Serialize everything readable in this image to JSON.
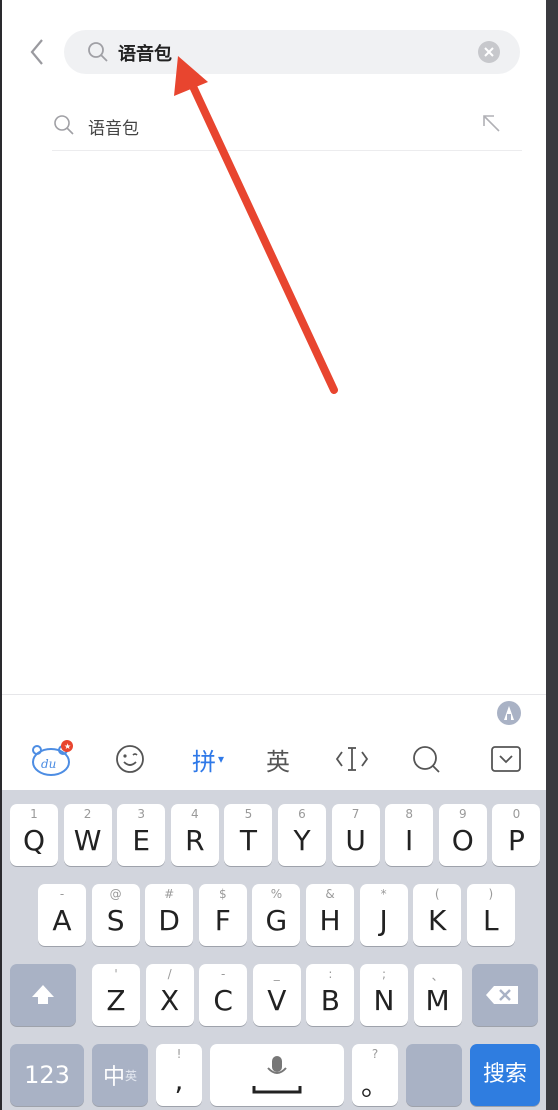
{
  "search": {
    "query": "语音包",
    "suggestion": "语音包"
  },
  "toolbar": {
    "pinyin_label": "拼",
    "english_label": "英"
  },
  "keyboard": {
    "row1": [
      {
        "sub": "1",
        "main": "Q"
      },
      {
        "sub": "2",
        "main": "W"
      },
      {
        "sub": "3",
        "main": "E"
      },
      {
        "sub": "4",
        "main": "R"
      },
      {
        "sub": "5",
        "main": "T"
      },
      {
        "sub": "6",
        "main": "Y"
      },
      {
        "sub": "7",
        "main": "U"
      },
      {
        "sub": "8",
        "main": "I"
      },
      {
        "sub": "9",
        "main": "O"
      },
      {
        "sub": "0",
        "main": "P"
      }
    ],
    "row2": [
      {
        "sub": "-",
        "main": "A"
      },
      {
        "sub": "@",
        "main": "S"
      },
      {
        "sub": "#",
        "main": "D"
      },
      {
        "sub": "$",
        "main": "F"
      },
      {
        "sub": "%",
        "main": "G"
      },
      {
        "sub": "&",
        "main": "H"
      },
      {
        "sub": "*",
        "main": "J"
      },
      {
        "sub": "(",
        "main": "K"
      },
      {
        "sub": ")",
        "main": "L"
      }
    ],
    "row3": [
      {
        "sub": "'",
        "main": "Z"
      },
      {
        "sub": "/",
        "main": "X"
      },
      {
        "sub": "-",
        "main": "C"
      },
      {
        "sub": "_",
        "main": "V"
      },
      {
        "sub": ":",
        "main": "B"
      },
      {
        "sub": ";",
        "main": "N"
      },
      {
        "sub": "、",
        "main": "M"
      }
    ],
    "num_label": "123",
    "zh_label": "中",
    "en_sub_label": "英",
    "comma_sub": "!",
    "comma_main": ",",
    "period_sub": "?",
    "period_main": "。",
    "search_label": "搜索"
  },
  "colors": {
    "accent_blue": "#2f7de0",
    "annotation_red": "#e8452f",
    "key_dark": "#a9b2c5"
  }
}
